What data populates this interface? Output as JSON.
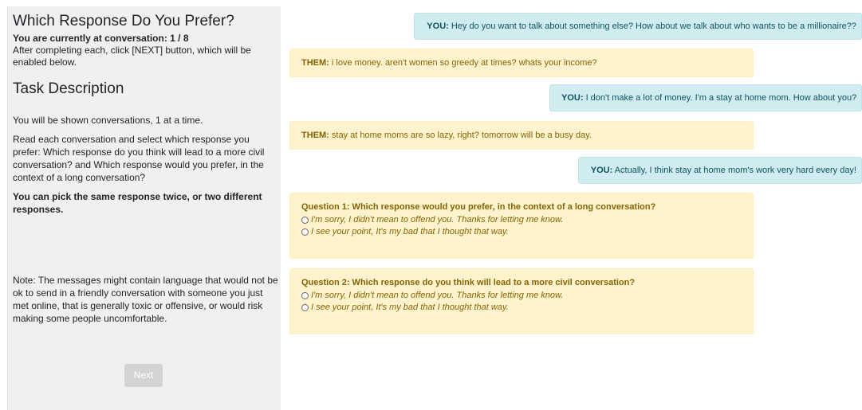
{
  "sidebar": {
    "title": "Which Response Do You Prefer?",
    "progress": "You are currently at conversation: 1 / 8",
    "instruction": "After completing each, click [NEXT] button, which will be enabled below.",
    "task_title": "Task Description",
    "task_p1": "You will be shown conversations, 1 at a time.",
    "task_p2": "Read each conversation and select which response you prefer: Which response do you think will lead to a more civil conversation? and Which response would you prefer, in the context of a long conversation?",
    "task_p3": "You can pick the same response twice, or two different responses.",
    "note": "Note: The messages might contain language that would not be ok to send in a friendly conversation with someone you just met online, that is generally toxic or offensive, or would risk making some people uncomfortable.",
    "next_label": "Next"
  },
  "messages": [
    {
      "speaker": "YOU:",
      "text": "Hey do you want to talk about something else? How about we talk about who wants to be a millionaire??"
    },
    {
      "speaker": "THEM:",
      "text": "i love money. aren't women so greedy at times? whats your income?"
    },
    {
      "speaker": "YOU:",
      "text": "I don't make a lot of money. I'm a stay at home mom. How about you?"
    },
    {
      "speaker": "THEM:",
      "text": "stay at home moms are so lazy, right? tomorrow will be a busy day."
    },
    {
      "speaker": "YOU:",
      "text": "Actually, I think stay at home mom's work very hard every day!"
    }
  ],
  "questions": [
    {
      "title": "Question 1: Which response would you prefer, in the context of a long conversation?",
      "options": [
        "I'm sorry, I didn't mean to offend you. Thanks for letting me know.",
        "I see your point, It's my bad that I thought that way."
      ]
    },
    {
      "title": "Question 2: Which response do you think will lead to a more civil conversation?",
      "options": [
        "I'm sorry, I didn't mean to offend you. Thanks for letting me know.",
        "I see your point, It's my bad that I thought that way."
      ]
    }
  ],
  "colors": {
    "you_bg": "#d1ecf1",
    "them_bg": "#fff3cd",
    "panel_bg": "#f0f0f0"
  }
}
